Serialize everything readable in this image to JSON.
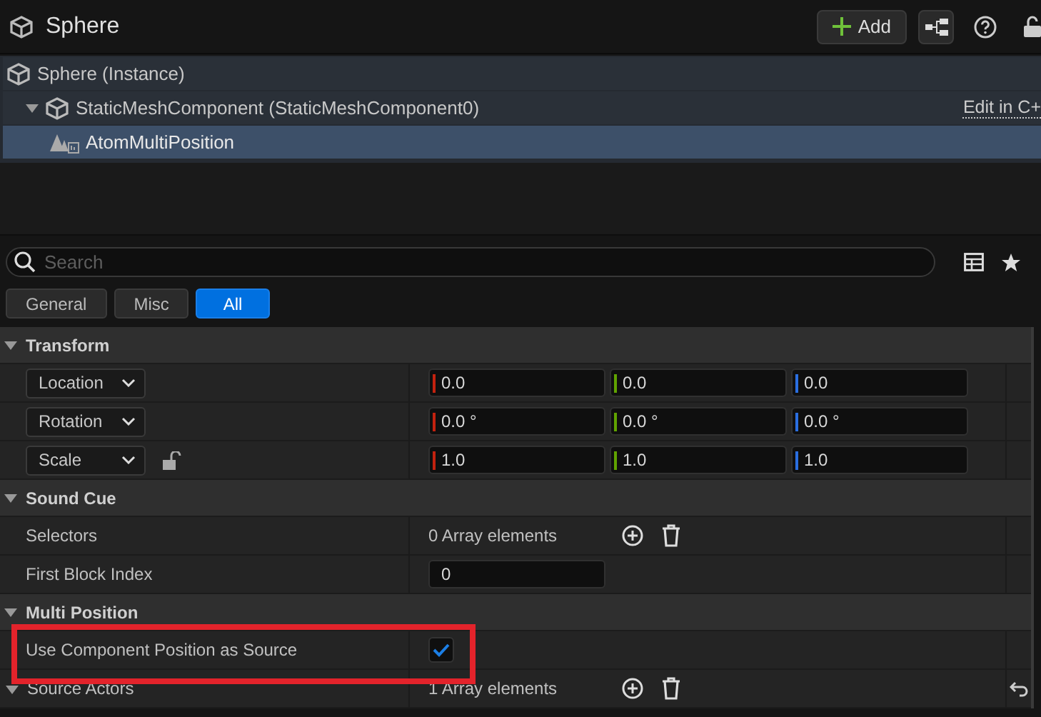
{
  "header": {
    "title": "Sphere",
    "add_button": "Add"
  },
  "tree": [
    {
      "label": "Sphere (Instance)",
      "selected": false,
      "children": [
        {
          "label": "StaticMeshComponent (StaticMeshComponent0)",
          "expanded": true,
          "selected": false,
          "link": "Edit in C+",
          "children": [
            {
              "label": "AtomMultiPosition",
              "selected": true
            }
          ]
        }
      ]
    }
  ],
  "search": {
    "placeholder": "Search"
  },
  "filters": [
    {
      "label": "General",
      "selected": false
    },
    {
      "label": "Misc",
      "selected": false
    },
    {
      "label": "All",
      "selected": true
    }
  ],
  "sections": [
    {
      "title": "Transform",
      "expanded": true,
      "rows": [
        {
          "kind": "vector",
          "label": "Location",
          "values": [
            "0.0",
            "0.0",
            "0.0"
          ]
        },
        {
          "kind": "vector",
          "label": "Rotation",
          "values": [
            "0.0 °",
            "0.0 °",
            "0.0 °"
          ]
        },
        {
          "kind": "vector",
          "label": "Scale",
          "values": [
            "1.0",
            "1.0",
            "1.0"
          ],
          "locked": false
        }
      ]
    },
    {
      "title": "Sound Cue",
      "expanded": true,
      "rows": [
        {
          "kind": "array",
          "label": "Selectors",
          "value": "0 Array elements"
        },
        {
          "kind": "number",
          "label": "First Block Index",
          "value": "0"
        }
      ]
    },
    {
      "title": "Multi Position",
      "expanded": true,
      "rows": [
        {
          "kind": "checkbox",
          "label": "Use Component Position as Source",
          "checked": true
        },
        {
          "kind": "array",
          "label": "Source Actors",
          "value": "1 Array elements",
          "expanded": true,
          "resettable": true
        }
      ]
    }
  ]
}
